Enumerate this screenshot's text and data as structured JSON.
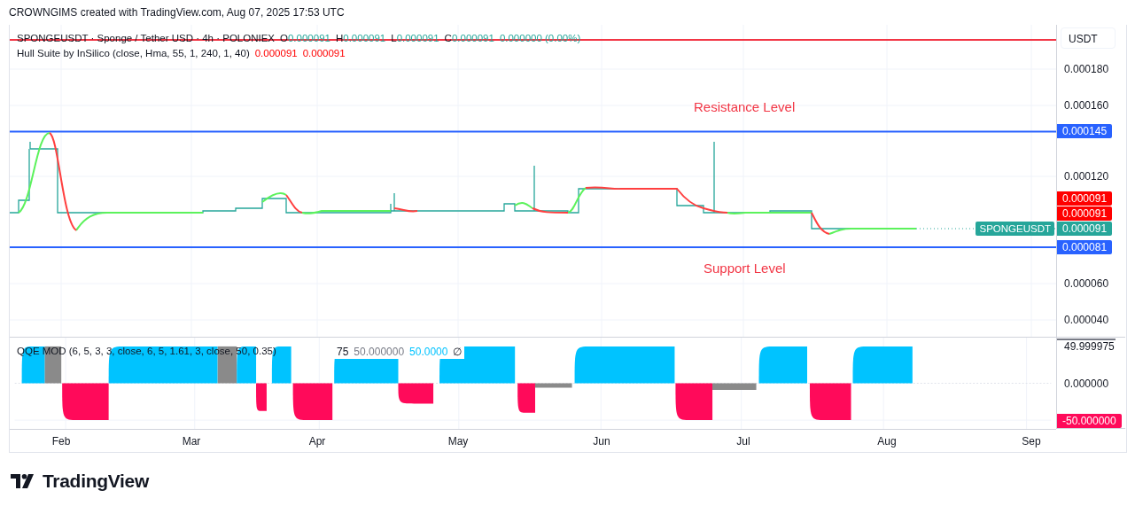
{
  "header": {
    "text": "CROWNGIMS created with TradingView.com, Aug 07, 2025 17:53 UTC"
  },
  "legend": {
    "symbol": "SPONGEUSDT · Sponge / Tether USD · 4h · POLONIEX",
    "ohlc": [
      {
        "key": "O",
        "value": "0.000091"
      },
      {
        "key": "H",
        "value": "0.000091"
      },
      {
        "key": "L",
        "value": "0.000091"
      },
      {
        "key": "C",
        "value": "0.000091"
      }
    ],
    "change": "0.000000 (0.00%)"
  },
  "indicator": {
    "name": "Hull Suite by InSilico (close, Hma, 55, 1, 240, 1, 40)",
    "values": [
      "0.000091",
      "0.000091"
    ]
  },
  "drawings": [
    {
      "label": "Resistance Level"
    },
    {
      "label": "Support Level"
    }
  ],
  "price_axis": {
    "currency": "USDT",
    "ticks": [
      "0.000180",
      "0.000160",
      "0.000120",
      "0.000060",
      "0.000040"
    ],
    "badges": [
      {
        "text": "0.000145",
        "color": "#2962ff"
      },
      {
        "text": "0.000091",
        "color": "#ff0000"
      },
      {
        "text": "0.000091",
        "color": "#ff0000"
      },
      {
        "text": "0.000091",
        "color": "#26a69a",
        "symbol": "SPONGEUSDT"
      },
      {
        "text": "0.000081",
        "color": "#2962ff"
      }
    ]
  },
  "qqe": {
    "name": "QQE MOD (6, 5, 3, 3, close, 6, 5, 1.61, 3, close, 50, 0.35)",
    "values": [
      {
        "text": "75"
      },
      {
        "text": "50.000000",
        "color": "#787b86"
      },
      {
        "text": "50.0000",
        "color": "#00c3ff"
      },
      {
        "text": "∅"
      }
    ],
    "axis": {
      "ticks": [
        "49.999975",
        "0.000000"
      ],
      "badge": {
        "text": "-50.000000",
        "color": "#ff0a5a"
      }
    }
  },
  "time_axis": [
    "Feb",
    "Mar",
    "Apr",
    "May",
    "Jun",
    "Jul",
    "Aug",
    "Sep"
  ],
  "brand": {
    "name": "TradingView"
  }
}
